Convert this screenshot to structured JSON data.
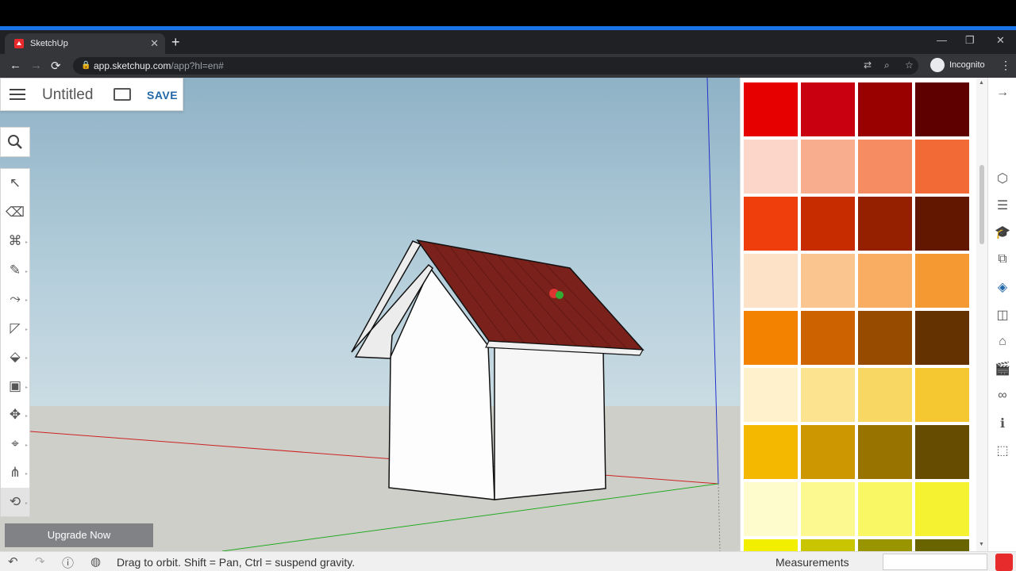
{
  "browser": {
    "tab_title": "SketchUp",
    "tab_close": "✕",
    "new_tab": "+",
    "minimize": "—",
    "maximize": "❐",
    "close": "✕",
    "back": "←",
    "forward": "→",
    "reload": "⟳",
    "url_host": "app.sketchup.com",
    "url_path": "/app?hl=en#",
    "incognito_label": "Incognito",
    "menu": "⋮"
  },
  "app": {
    "document_title": "Untitled",
    "save_label": "SAVE",
    "upgrade_label": "Upgrade Now",
    "status_text": "Drag to orbit. Shift = Pan, Ctrl = suspend gravity.",
    "measurements_label": "Measurements",
    "measurements_value": ""
  },
  "tools": [
    {
      "name": "select-tool",
      "glyph": "↖",
      "flyout": false
    },
    {
      "name": "eraser-tool",
      "glyph": "⌫",
      "flyout": false
    },
    {
      "name": "paint-bucket-tool",
      "glyph": "⌘",
      "flyout": true
    },
    {
      "name": "line-tool",
      "glyph": "✎",
      "flyout": true
    },
    {
      "name": "arc-tool",
      "glyph": "⤳",
      "flyout": true
    },
    {
      "name": "rectangle-tool",
      "glyph": "◸",
      "flyout": true
    },
    {
      "name": "push-pull-tool",
      "glyph": "⬙",
      "flyout": true
    },
    {
      "name": "offset-tool",
      "glyph": "▣",
      "flyout": true
    },
    {
      "name": "move-tool",
      "glyph": "✥",
      "flyout": true
    },
    {
      "name": "tape-measure-tool",
      "glyph": "⌖",
      "flyout": true
    },
    {
      "name": "walk-tool",
      "glyph": "⋔",
      "flyout": true
    },
    {
      "name": "orbit-tool",
      "glyph": "⟲",
      "flyout": true,
      "active": true
    }
  ],
  "swatch_colors": [
    "#e60000",
    "#c8000f",
    "#990000",
    "#5e0000",
    "#fdd6ca",
    "#f8ad8f",
    "#f58c62",
    "#f26a35",
    "#ef3d0b",
    "#c72c00",
    "#952000",
    "#611700",
    "#fde2c8",
    "#fbc590",
    "#f8ad62",
    "#f59a32",
    "#f28200",
    "#cc6300",
    "#974b00",
    "#633200",
    "#fef1cb",
    "#fbe38f",
    "#f8d762",
    "#f5c832",
    "#f5b800",
    "#cc9700",
    "#997300",
    "#664c00",
    "#fefbcc",
    "#fcf991",
    "#faf765",
    "#f5f331",
    "#f2f000",
    "#c9c500",
    "#989500",
    "#686500"
  ],
  "rail": [
    {
      "name": "collapse-panel-icon",
      "glyph": "→"
    },
    {
      "name": "entity-info-icon",
      "glyph": "⬡"
    },
    {
      "name": "outliner-icon",
      "glyph": "☰"
    },
    {
      "name": "instructor-icon",
      "glyph": "🎓"
    },
    {
      "name": "components-icon",
      "glyph": "⧉"
    },
    {
      "name": "materials-icon",
      "glyph": "◈",
      "active": true
    },
    {
      "name": "styles-icon",
      "glyph": "◫"
    },
    {
      "name": "tags-icon",
      "glyph": "⌂"
    },
    {
      "name": "scenes-icon",
      "glyph": "🎬"
    },
    {
      "name": "display-icon",
      "glyph": "∞"
    },
    {
      "name": "model-info-icon",
      "glyph": "ℹ"
    },
    {
      "name": "solid-inspector-icon",
      "glyph": "⬚"
    }
  ],
  "colors": {
    "accent": "#2468a8",
    "roof": "#7a211b",
    "x_axis": "#cc2222",
    "y_axis": "#22aa22",
    "z_axis": "#2233cc"
  }
}
